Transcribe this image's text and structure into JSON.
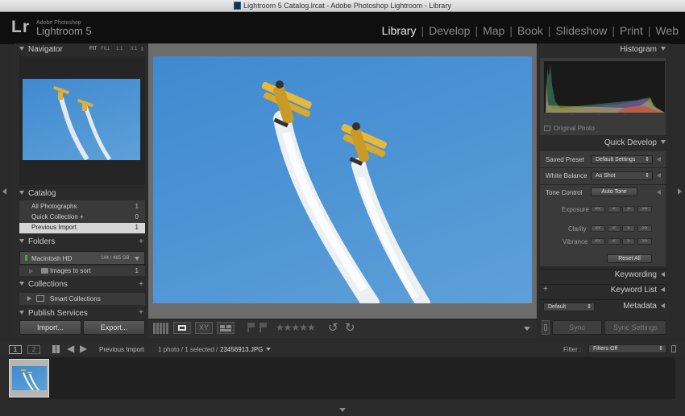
{
  "window": {
    "title": "Lightroom 5 Catalog.lrcat - Adobe Photoshop Lightroom - Library"
  },
  "identity": {
    "mark": "Lr",
    "brand_small": "Adobe Photoshop",
    "brand_big": "Lightroom 5"
  },
  "modules": [
    "Library",
    "Develop",
    "Map",
    "Book",
    "Slideshow",
    "Print",
    "Web"
  ],
  "navigator": {
    "title": "Navigator",
    "zoom_fit": "FIT",
    "zoom_fill": "FILL",
    "zoom_1": "1:1",
    "zoom_3": "3:1"
  },
  "catalog": {
    "title": "Catalog",
    "items": [
      {
        "label": "All Photographs",
        "count": "1"
      },
      {
        "label": "Quick Collection +",
        "count": "0"
      },
      {
        "label": "Previous Import",
        "count": "1"
      }
    ]
  },
  "folders": {
    "title": "Folders",
    "plus": "+",
    "volume": "Macintosh HD",
    "volume_size": "144 / 465 GB",
    "folder": "Images to sort",
    "folder_count": "1"
  },
  "collections": {
    "title": "Collections",
    "plus": "+",
    "item": "Smart Collections"
  },
  "publish": {
    "title": "Publish Services",
    "plus": "+"
  },
  "left_buttons": {
    "import": "Import...",
    "export": "Export..."
  },
  "histogram": {
    "title": "Histogram",
    "original_photo": "Original Photo"
  },
  "quick_develop": {
    "title": "Quick Develop",
    "saved_preset_label": "Saved Preset",
    "saved_preset_value": "Default Settings",
    "white_balance_label": "White Balance",
    "white_balance_value": "As Shot",
    "tone_control_label": "Tone Control",
    "auto_tone": "Auto Tone",
    "exposure": "Exposure",
    "clarity": "Clarity",
    "vibrance": "Vibrance",
    "reset_all": "Reset All"
  },
  "keywording": {
    "title": "Keywording"
  },
  "keyword_list": {
    "title": "Keyword List",
    "plus": "+"
  },
  "metadata": {
    "title": "Metadata",
    "preset": "Default"
  },
  "sync": {
    "sync": "Sync",
    "sync_settings": "Sync Settings"
  },
  "filmstrip_bar": {
    "page1": "1",
    "page2": "2",
    "source": "Previous Import",
    "info": "1 photo / 1 selected /",
    "filename": "23456913.JPG",
    "filter_label": "Filter :",
    "filter_value": "Filters Off"
  },
  "colors": {
    "accent": "#e8e8e8",
    "sky": "#4a92d4"
  }
}
